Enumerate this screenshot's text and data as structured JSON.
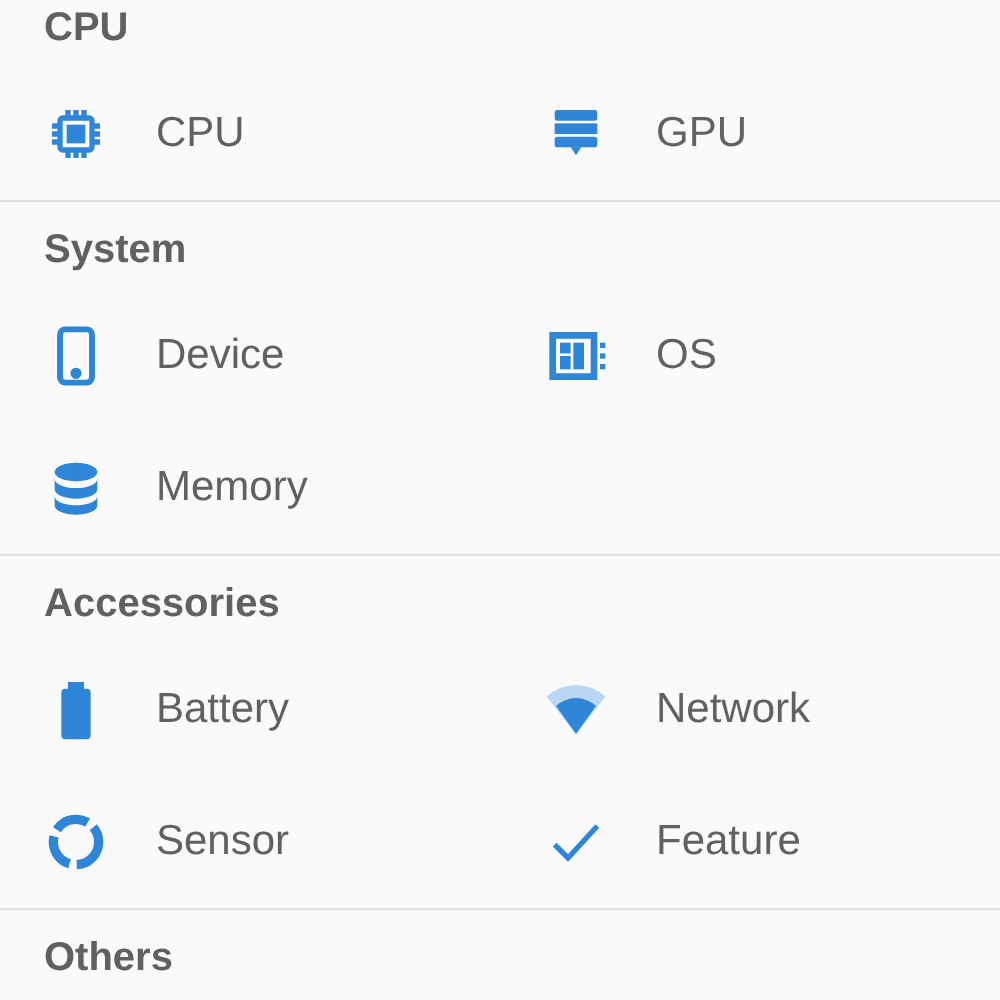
{
  "sections": [
    {
      "title": "CPU",
      "items": [
        "CPU",
        "GPU"
      ]
    },
    {
      "title": "System",
      "items": [
        "Device",
        "OS",
        "Memory"
      ]
    },
    {
      "title": "Accessories",
      "items": [
        "Battery",
        "Network",
        "Sensor",
        "Feature"
      ]
    },
    {
      "title": "Others"
    }
  ]
}
